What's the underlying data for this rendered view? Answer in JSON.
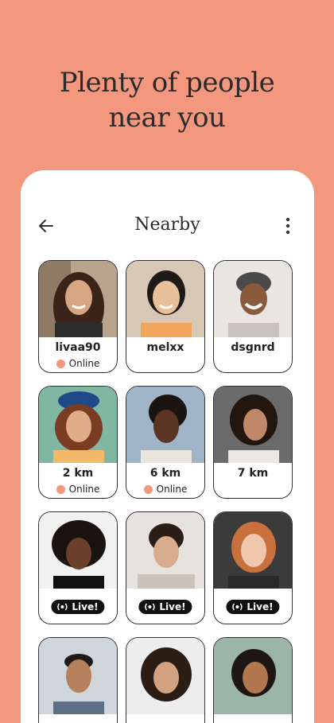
{
  "headline": {
    "line1": "Plenty of people",
    "line2": "near you"
  },
  "header": {
    "title": "Nearby",
    "back_icon": "arrow-left-icon",
    "menu_icon": "more-vertical-icon"
  },
  "colors": {
    "accent": "#f4977f",
    "text": "#2b2b2b",
    "badge": "#111111"
  },
  "profiles": [
    {
      "label": "livaa90",
      "status": "Online"
    },
    {
      "label": "melxx",
      "status": ""
    },
    {
      "label": "dsgnrd",
      "status": ""
    },
    {
      "label": "2 km",
      "status": "Online"
    },
    {
      "label": "6 km",
      "status": "Online"
    },
    {
      "label": "7 km",
      "status": ""
    },
    {
      "label": "",
      "live": "Live!"
    },
    {
      "label": "",
      "live": "Live!"
    },
    {
      "label": "",
      "live": "Live!"
    },
    {
      "label": ""
    },
    {
      "label": ""
    },
    {
      "label": ""
    }
  ]
}
